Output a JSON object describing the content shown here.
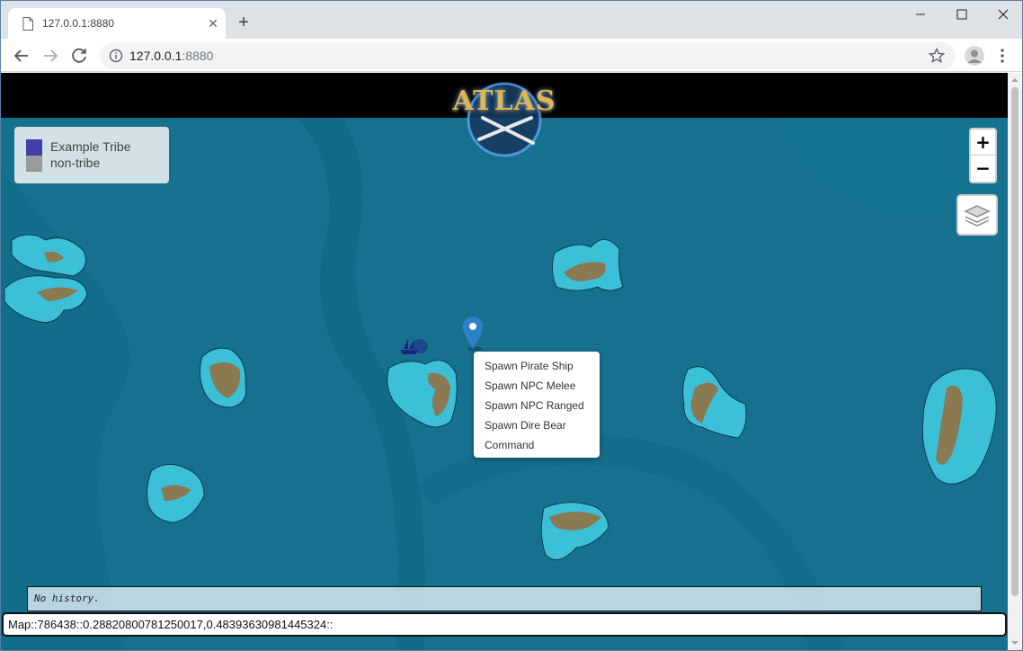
{
  "browser": {
    "tab_title": "127.0.0.1:8880",
    "url_host": "127.0.0.1",
    "url_port": ":8880"
  },
  "page": {
    "logo_text": "ATLAS",
    "legend": [
      {
        "label": "Example Tribe",
        "color": "#4040a8"
      },
      {
        "label": "non-tribe",
        "color": "#9a9a9a"
      }
    ],
    "zoom_in_label": "+",
    "zoom_out_label": "−",
    "context_menu": [
      {
        "label": "Spawn Pirate Ship"
      },
      {
        "label": "Spawn NPC Melee"
      },
      {
        "label": "Spawn NPC Ranged"
      },
      {
        "label": "Spawn Dire Bear"
      },
      {
        "label": "Command"
      }
    ],
    "history_text": "No history.",
    "command_value": "Map::786438::0.28820800781250017,0.48393630981445324::"
  },
  "colors": {
    "ocean": "#15718e",
    "shallow": "#3cc0d8",
    "land": "#8a7a52",
    "marker": "#2b82cb",
    "ship": "#1a237e"
  },
  "icons": [
    "page-icon",
    "close-icon",
    "plus-icon",
    "minimize-icon",
    "maximize-icon",
    "back-arrow-icon",
    "forward-arrow-icon",
    "reload-icon",
    "info-icon",
    "star-icon",
    "profile-icon",
    "kebab-menu-icon",
    "layers-icon",
    "map-pin-icon",
    "ship-icon"
  ]
}
